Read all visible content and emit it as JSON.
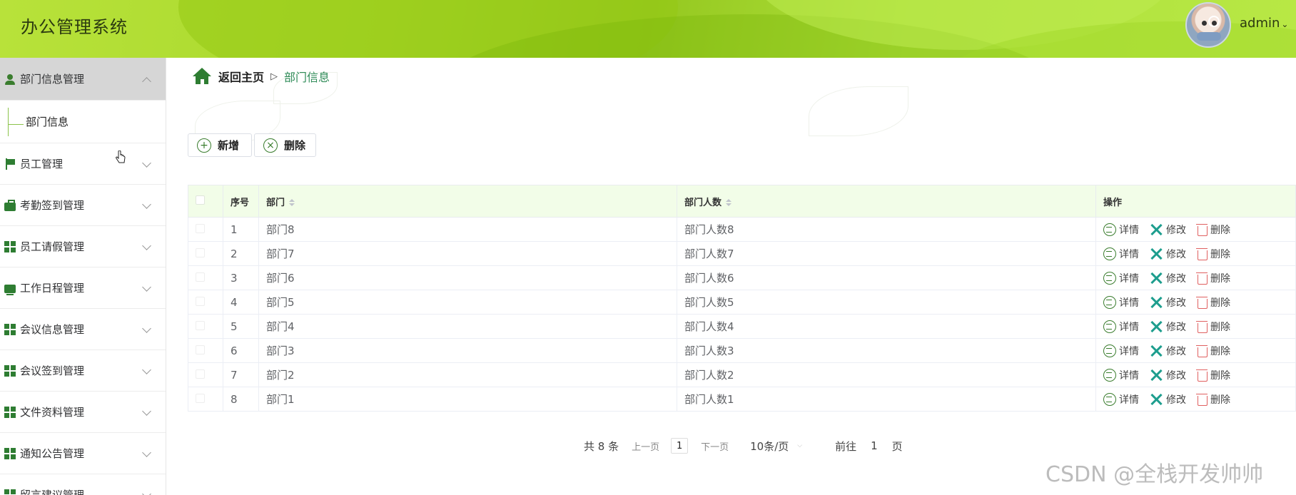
{
  "header": {
    "title": "办公管理系统",
    "user": "admin"
  },
  "sidebar": {
    "items": [
      {
        "label": "部门信息管理",
        "icon": "person-icon",
        "expanded": true,
        "sub": [
          "部门信息"
        ]
      },
      {
        "label": "员工管理",
        "icon": "flag-icon"
      },
      {
        "label": "考勤签到管理",
        "icon": "briefcase-icon"
      },
      {
        "label": "员工请假管理",
        "icon": "grid-icon"
      },
      {
        "label": "工作日程管理",
        "icon": "monitor-icon"
      },
      {
        "label": "会议信息管理",
        "icon": "grid-icon"
      },
      {
        "label": "会议签到管理",
        "icon": "grid-icon"
      },
      {
        "label": "文件资料管理",
        "icon": "grid-icon"
      },
      {
        "label": "通知公告管理",
        "icon": "grid-icon"
      },
      {
        "label": "留言建议管理",
        "icon": "grid-icon"
      }
    ]
  },
  "breadcrumb": {
    "home": "返回主页",
    "current": "部门信息"
  },
  "toolbar": {
    "add_label": "新增",
    "delete_label": "删除"
  },
  "table": {
    "columns": [
      "序号",
      "部门",
      "部门人数",
      "操作"
    ],
    "rows": [
      {
        "no": "1",
        "dept": "部门8",
        "count": "部门人数8"
      },
      {
        "no": "2",
        "dept": "部门7",
        "count": "部门人数7"
      },
      {
        "no": "3",
        "dept": "部门6",
        "count": "部门人数6"
      },
      {
        "no": "4",
        "dept": "部门5",
        "count": "部门人数5"
      },
      {
        "no": "5",
        "dept": "部门4",
        "count": "部门人数4"
      },
      {
        "no": "6",
        "dept": "部门3",
        "count": "部门人数3"
      },
      {
        "no": "7",
        "dept": "部门2",
        "count": "部门人数2"
      },
      {
        "no": "8",
        "dept": "部门1",
        "count": "部门人数1"
      }
    ],
    "actions": {
      "detail": "详情",
      "edit": "修改",
      "delete": "删除"
    }
  },
  "pagination": {
    "total": "共 8 条",
    "prev": "上一页",
    "current_page": "1",
    "next": "下一页",
    "page_size": "10条/页",
    "goto_label": "前往",
    "goto_value": "1",
    "goto_suffix": "页"
  },
  "watermark": "CSDN @全栈开发帅帅",
  "colors": {
    "accent": "#2e7d32",
    "header_green": "#a8d82c",
    "table_header_bg": "#f2fde8",
    "delete_red": "#e06060",
    "edit_teal": "#1e9e8e"
  }
}
